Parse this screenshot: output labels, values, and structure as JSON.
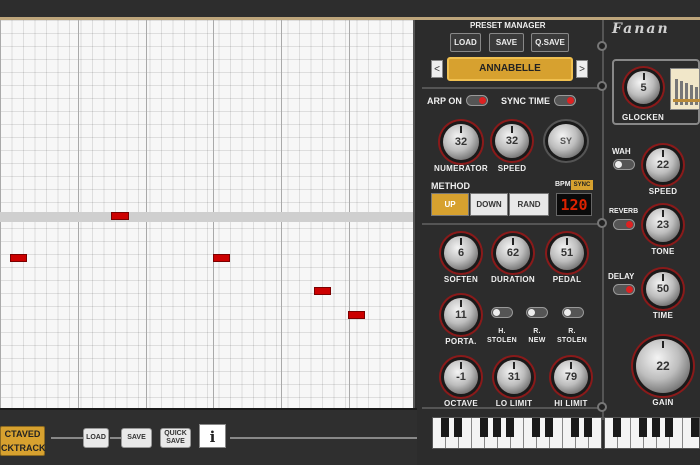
{
  "preset_manager": {
    "title": "PRESET MANAGER",
    "load": "LOAD",
    "save": "SAVE",
    "qsave": "Q.SAVE",
    "prev": "<",
    "next": ">",
    "name": "ANNABELLE"
  },
  "logo": "Fanan",
  "toggles": {
    "arp_on": "ARP ON",
    "sync_time": "SYNC TIME"
  },
  "knobs": {
    "numerator": {
      "label": "NUMERATOR",
      "value": "32"
    },
    "speed": {
      "label": "SPEED",
      "value": "32"
    },
    "sy": {
      "value": "SY"
    },
    "soften": {
      "label": "SOFTEN",
      "value": "6"
    },
    "duration": {
      "label": "DURATION",
      "value": "62"
    },
    "pedal": {
      "label": "PEDAL",
      "value": "51"
    },
    "porta": {
      "label": "PORTA.",
      "value": "11"
    },
    "octave": {
      "label": "OCTAVE",
      "value": "-1"
    },
    "lo_limit": {
      "label": "LO LIMIT",
      "value": "31"
    },
    "hi_limit": {
      "label": "HI LIMIT",
      "value": "79"
    },
    "glocken": {
      "label": "GLOCKEN",
      "value": "5"
    },
    "wah_speed": {
      "label": "SPEED",
      "value": "22"
    },
    "reverb_tone": {
      "label": "TONE",
      "value": "23"
    },
    "delay_time": {
      "label": "TIME",
      "value": "50"
    },
    "gain": {
      "label": "GAIN",
      "value": "22"
    }
  },
  "small_toggles": {
    "h_stolen": "H.\nSTOLEN",
    "r_new": "R.\nNEW",
    "r_stolen": "R.\nSTOLEN"
  },
  "method": {
    "title": "METHOD",
    "up": "UP",
    "down": "DOWN",
    "rand": "RAND",
    "selected": "UP"
  },
  "bpm": {
    "label": "BPM",
    "sync": "SYNC",
    "value": "120"
  },
  "fx": {
    "wah": "WAH",
    "reverb": "REVERB",
    "delay": "DELAY"
  },
  "bottom": {
    "octaved_line1": "CTAVED",
    "octaved_line2": "CKTRACK",
    "load": "LOAD",
    "save": "SAVE",
    "quick_save_1": "QUICK",
    "quick_save_2": "SAVE",
    "info": "i"
  },
  "colors": {
    "accent_gold": "#d7a12f",
    "note_red": "#cc0000",
    "knob_ring": "#8a1a1a"
  }
}
